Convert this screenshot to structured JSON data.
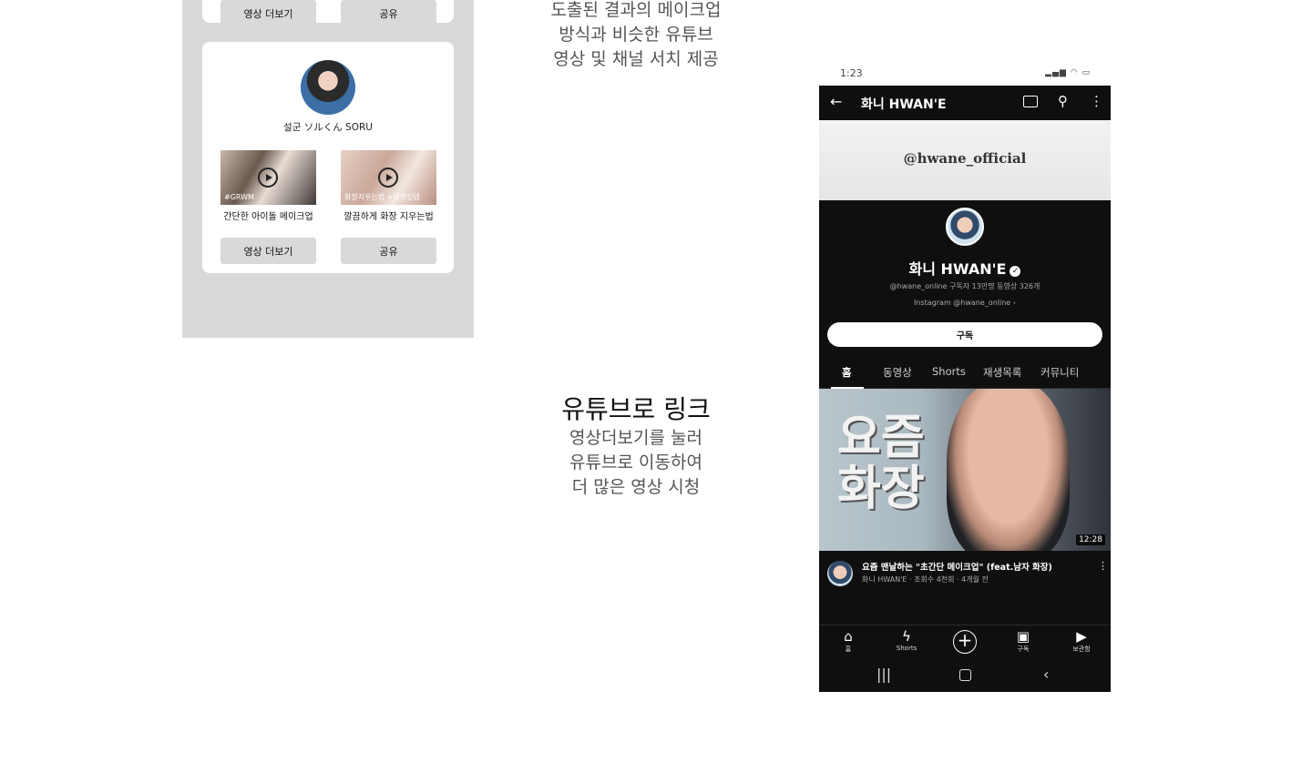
{
  "wireframe": {
    "top_card": {
      "more_label": "영상 더보기",
      "share_label": "공유"
    },
    "card": {
      "creator_name": "설군 ソルくん SORU",
      "videos": [
        {
          "title": "간단한 아이돌 메이크업",
          "thumb_text": "#GRWM"
        },
        {
          "title": "깔끔하게 화장 지우는법",
          "thumb_text": "화장지우는법 +클렌징템"
        }
      ],
      "more_label": "영상 더보기",
      "share_label": "공유"
    }
  },
  "descriptions": {
    "top": [
      "도출된 결과의 메이크업",
      "방식과 비슷한 유튜브",
      "영상 및 채널 서치 제공"
    ],
    "heading": "유튜브로 링크",
    "bottom": [
      "영상더보기를 눌러",
      "유튜브로 이동하여",
      "더 많은 영상 시청"
    ]
  },
  "phone": {
    "status_time": "1:23",
    "appbar": {
      "back_icon": "arrow-left-icon",
      "title": "화니 HWAN'E",
      "icons": [
        "cast-icon",
        "search-icon",
        "more-vert-icon"
      ]
    },
    "banner_handle": "@hwane_official",
    "channel": {
      "name": "화니 HWAN'E",
      "meta": "@hwane_online  구독자 13만명  동영상 326개",
      "link": "Instagram  @hwane_online",
      "subscribe_label": "구독"
    },
    "tabs": [
      "홈",
      "동영상",
      "Shorts",
      "재생목록",
      "커뮤니티"
    ],
    "active_tab": "홈",
    "featured_video": {
      "thumbnail_text": [
        "요즘",
        "화장"
      ],
      "duration": "12:28",
      "title": "요즘 맨날하는 \"초간단 메이크업\" (feat.남자 화장)",
      "subtitle": "화니 HWAN'E · 조회수 4천회 · 4개월 전"
    },
    "bottom_nav": [
      {
        "label": "홈",
        "icon": "home-icon"
      },
      {
        "label": "Shorts",
        "icon": "shorts-icon"
      },
      {
        "label": "",
        "icon": "add-icon"
      },
      {
        "label": "구독",
        "icon": "subscriptions-icon"
      },
      {
        "label": "보관함",
        "icon": "library-icon"
      }
    ],
    "system_nav": [
      "recents-icon",
      "home-button-icon",
      "back-icon"
    ]
  }
}
